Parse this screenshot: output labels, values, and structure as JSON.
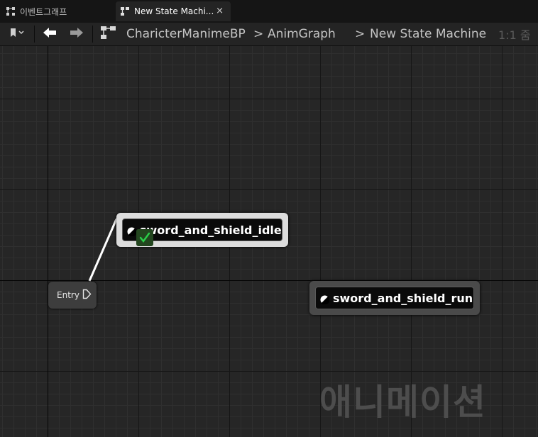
{
  "tabs": [
    {
      "label": "이벤트그래프",
      "icon": "event-graph-icon",
      "active": false
    },
    {
      "label": "New State Machi...",
      "icon": "state-machine-icon",
      "active": true,
      "close": "×"
    }
  ],
  "toolbar": {
    "bookmark_icon": "bookmark-icon",
    "back_icon": "back-arrow-icon",
    "forward_icon": "forward-arrow-icon",
    "breadcrumbs": [
      "CharicterManimeBP",
      "AnimGraph",
      "New State Machine"
    ],
    "breadcrumb_separator": ">",
    "zoom_label": "1:1 줌"
  },
  "graph": {
    "entry": {
      "label": "Entry"
    },
    "states": [
      {
        "label": "sword_and_shield_idle",
        "active": true
      },
      {
        "label": "sword_and_shield_run",
        "active": false
      }
    ],
    "watermark": "애니메이션"
  },
  "colors": {
    "background": "#151515",
    "toolbar": "#242424",
    "graph": "#262626",
    "active_state_border": "#dcdcdc",
    "inactive_state_border": "#4a4a4a",
    "check_green": "#2bd14a",
    "watermark": "#4d4d4d"
  }
}
